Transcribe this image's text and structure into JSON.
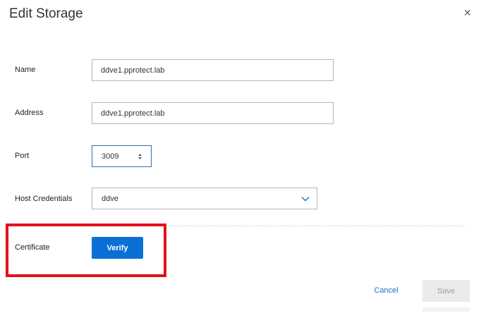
{
  "dialog": {
    "title": "Edit Storage",
    "close_icon": "close-icon"
  },
  "form": {
    "name": {
      "label": "Name",
      "value": "ddve1.pprotect.lab"
    },
    "address": {
      "label": "Address",
      "value": "ddve1.pprotect.lab"
    },
    "port": {
      "label": "Port",
      "value": "3009"
    },
    "host_credentials": {
      "label": "Host Credentials",
      "value": "ddve"
    },
    "certificate": {
      "label": "Certificate",
      "verify_label": "Verify"
    }
  },
  "footer": {
    "cancel_label": "Cancel",
    "save_label": "Save"
  },
  "colors": {
    "primary": "#0a70d6",
    "link": "#1a6fc4",
    "highlight": "#e3101a",
    "disabled_bg": "#ebebeb"
  }
}
